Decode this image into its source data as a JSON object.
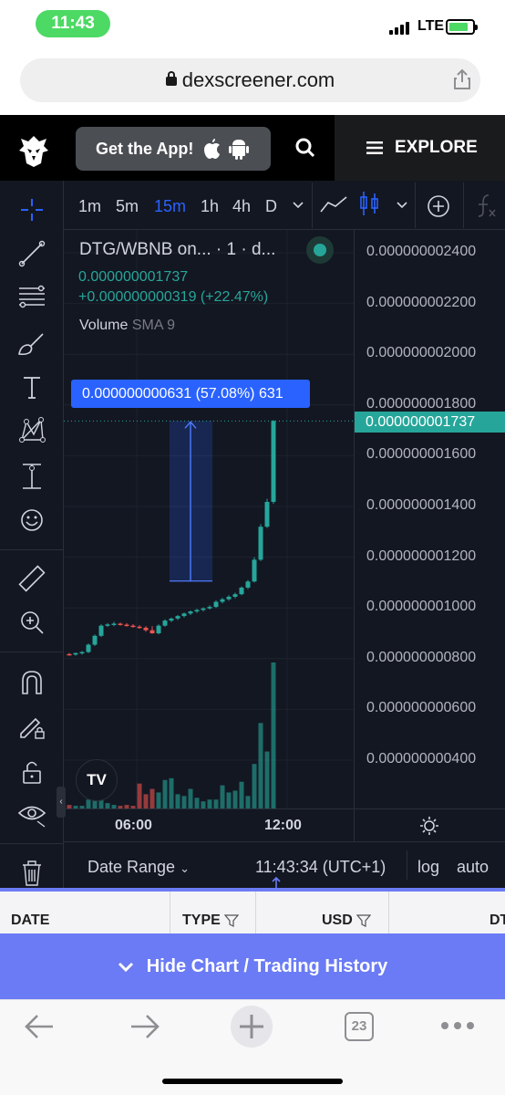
{
  "status_bar": {
    "time": "11:43",
    "network": "LTE"
  },
  "browser": {
    "url": "dexscreener.com",
    "tab_count": "23"
  },
  "header": {
    "get_app_label": "Get the App!",
    "explore_label": "EXPLORE"
  },
  "toolbar": {
    "timeframes": [
      "1m",
      "5m",
      "15m",
      "1h",
      "4h",
      "D"
    ],
    "active_timeframe": "15m"
  },
  "legend": {
    "title": "DTG/WBNB on... · 1 · d...",
    "price": "0.000000001737",
    "change": "+0.000000000319 (+22.47%)",
    "volume_label": "Volume",
    "volume_indicator": "SMA 9"
  },
  "measure": {
    "label": "0.000000000631 (57.08%) 631"
  },
  "price_axis": {
    "labels": [
      "0.000000002400",
      "0.000000002200",
      "0.000000002000",
      "0.000000001800",
      "0.000000001600",
      "0.000000001400",
      "0.000000001200",
      "0.000000001000",
      "0.000000000800",
      "0.000000000600",
      "0.000000000400"
    ],
    "current_price_tag": "0.000000001737"
  },
  "time_axis": {
    "labels": [
      "06:00",
      "12:00"
    ]
  },
  "bottom_controls": {
    "date_range": "Date Range",
    "clock": "11:43:34 (UTC+1)",
    "log": "log",
    "auto": "auto"
  },
  "history_table": {
    "columns": [
      "DATE",
      "TYPE",
      "USD",
      "DT"
    ]
  },
  "hide_chart_label": "Hide Chart / Trading History",
  "colors": {
    "up": "#26a69a",
    "down": "#ef5350",
    "accent": "#2962ff",
    "chart_bg": "#131722",
    "banner": "#6a7bf5"
  },
  "chart_data": {
    "type": "candlestick",
    "pair": "DTG/WBNB",
    "interval": "15m",
    "ylim": [
      3e-10,
      2.5e-09
    ],
    "candles": [
      {
        "o": 8.18e-10,
        "h": 8.22e-10,
        "l": 8.12e-10,
        "c": 8.16e-10
      },
      {
        "o": 8.16e-10,
        "h": 8.24e-10,
        "l": 8.12e-10,
        "c": 8.22e-10
      },
      {
        "o": 8.22e-10,
        "h": 8.3e-10,
        "l": 8.16e-10,
        "c": 8.26e-10
      },
      {
        "o": 8.26e-10,
        "h": 8.6e-10,
        "l": 8.22e-10,
        "c": 8.55e-10
      },
      {
        "o": 8.55e-10,
        "h": 8.95e-10,
        "l": 8.5e-10,
        "c": 8.9e-10
      },
      {
        "o": 8.9e-10,
        "h": 9.35e-10,
        "l": 8.85e-10,
        "c": 9.3e-10
      },
      {
        "o": 9.3e-10,
        "h": 9.4e-10,
        "l": 9.25e-10,
        "c": 9.35e-10
      },
      {
        "o": 9.35e-10,
        "h": 9.45e-10,
        "l": 9.28e-10,
        "c": 9.38e-10
      },
      {
        "o": 9.38e-10,
        "h": 9.42e-10,
        "l": 9.3e-10,
        "c": 9.34e-10
      },
      {
        "o": 9.34e-10,
        "h": 9.4e-10,
        "l": 9.26e-10,
        "c": 9.3e-10
      },
      {
        "o": 9.3e-10,
        "h": 9.36e-10,
        "l": 9.22e-10,
        "c": 9.26e-10
      },
      {
        "o": 9.26e-10,
        "h": 9.32e-10,
        "l": 9.18e-10,
        "c": 9.22e-10
      },
      {
        "o": 9.22e-10,
        "h": 9.28e-10,
        "l": 9.06e-10,
        "c": 9.12e-10
      },
      {
        "o": 9.12e-10,
        "h": 9.28e-10,
        "l": 8.98e-10,
        "c": 9e-10
      },
      {
        "o": 9e-10,
        "h": 9.35e-10,
        "l": 8.96e-10,
        "c": 9.3e-10
      },
      {
        "o": 9.3e-10,
        "h": 9.55e-10,
        "l": 9.26e-10,
        "c": 9.5e-10
      },
      {
        "o": 9.5e-10,
        "h": 9.62e-10,
        "l": 9.44e-10,
        "c": 9.58e-10
      },
      {
        "o": 9.58e-10,
        "h": 9.72e-10,
        "l": 9.52e-10,
        "c": 9.68e-10
      },
      {
        "o": 9.68e-10,
        "h": 9.82e-10,
        "l": 9.62e-10,
        "c": 9.78e-10
      },
      {
        "o": 9.78e-10,
        "h": 9.9e-10,
        "l": 9.72e-10,
        "c": 9.86e-10
      },
      {
        "o": 9.86e-10,
        "h": 9.96e-10,
        "l": 9.8e-10,
        "c": 9.92e-10
      },
      {
        "o": 9.92e-10,
        "h": 1.002e-09,
        "l": 9.86e-10,
        "c": 9.98e-10
      },
      {
        "o": 9.98e-10,
        "h": 1.01e-09,
        "l": 9.94e-10,
        "c": 1.004e-09
      },
      {
        "o": 1.004e-09,
        "h": 1.03e-09,
        "l": 1e-09,
        "c": 1.024e-09
      },
      {
        "o": 1.024e-09,
        "h": 1.04e-09,
        "l": 1.018e-09,
        "c": 1.034e-09
      },
      {
        "o": 1.034e-09,
        "h": 1.05e-09,
        "l": 1.028e-09,
        "c": 1.044e-09
      },
      {
        "o": 1.044e-09,
        "h": 1.06e-09,
        "l": 1.038e-09,
        "c": 1.054e-09
      },
      {
        "o": 1.054e-09,
        "h": 1.085e-09,
        "l": 1.05e-09,
        "c": 1.08e-09
      },
      {
        "o": 1.08e-09,
        "h": 1.11e-09,
        "l": 1.074e-09,
        "c": 1.104e-09
      },
      {
        "o": 1.104e-09,
        "h": 1.2e-09,
        "l": 1.1e-09,
        "c": 1.19e-09
      },
      {
        "o": 1.19e-09,
        "h": 1.33e-09,
        "l": 1.185e-09,
        "c": 1.32e-09
      },
      {
        "o": 1.32e-09,
        "h": 1.43e-09,
        "l": 1.315e-09,
        "c": 1.418e-09
      },
      {
        "o": 1.418e-09,
        "h": 1.74e-09,
        "l": 1.41e-09,
        "c": 1.737e-09
      }
    ],
    "volume": [
      2,
      1.5,
      1.5,
      5,
      8,
      9,
      3,
      2,
      1.5,
      2,
      1.5,
      14,
      8,
      11,
      9,
      16,
      17,
      8,
      7,
      11,
      6,
      4,
      5,
      5,
      13,
      9,
      10,
      15,
      7,
      25,
      48,
      32,
      82
    ],
    "current_price": 1.737e-09,
    "measure": {
      "from": 1.106e-09,
      "to": 1.737e-09,
      "change": 6.31e-10,
      "percent": 57.08
    }
  }
}
